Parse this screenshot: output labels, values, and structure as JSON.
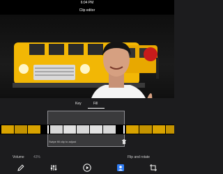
{
  "status": {
    "time": "6:04 PM"
  },
  "header": {
    "title": "Clip editor"
  },
  "tabs": [
    {
      "label": "Key"
    },
    {
      "label": "Fill"
    }
  ],
  "timeline": {
    "hint": "Swipe fill clip to adjust"
  },
  "properties": {
    "volume_label": "Volume",
    "volume_value": "43%",
    "flip_label": "Flip and rotate"
  },
  "toolbar": {
    "items": [
      "edit-icon",
      "adjust-icon",
      "play-icon",
      "person-layer-icon",
      "crop-icon"
    ]
  },
  "colors": {
    "accent": "#2f7df6",
    "bus_yellow": "#f2b705",
    "background": "#1c1c1e"
  }
}
